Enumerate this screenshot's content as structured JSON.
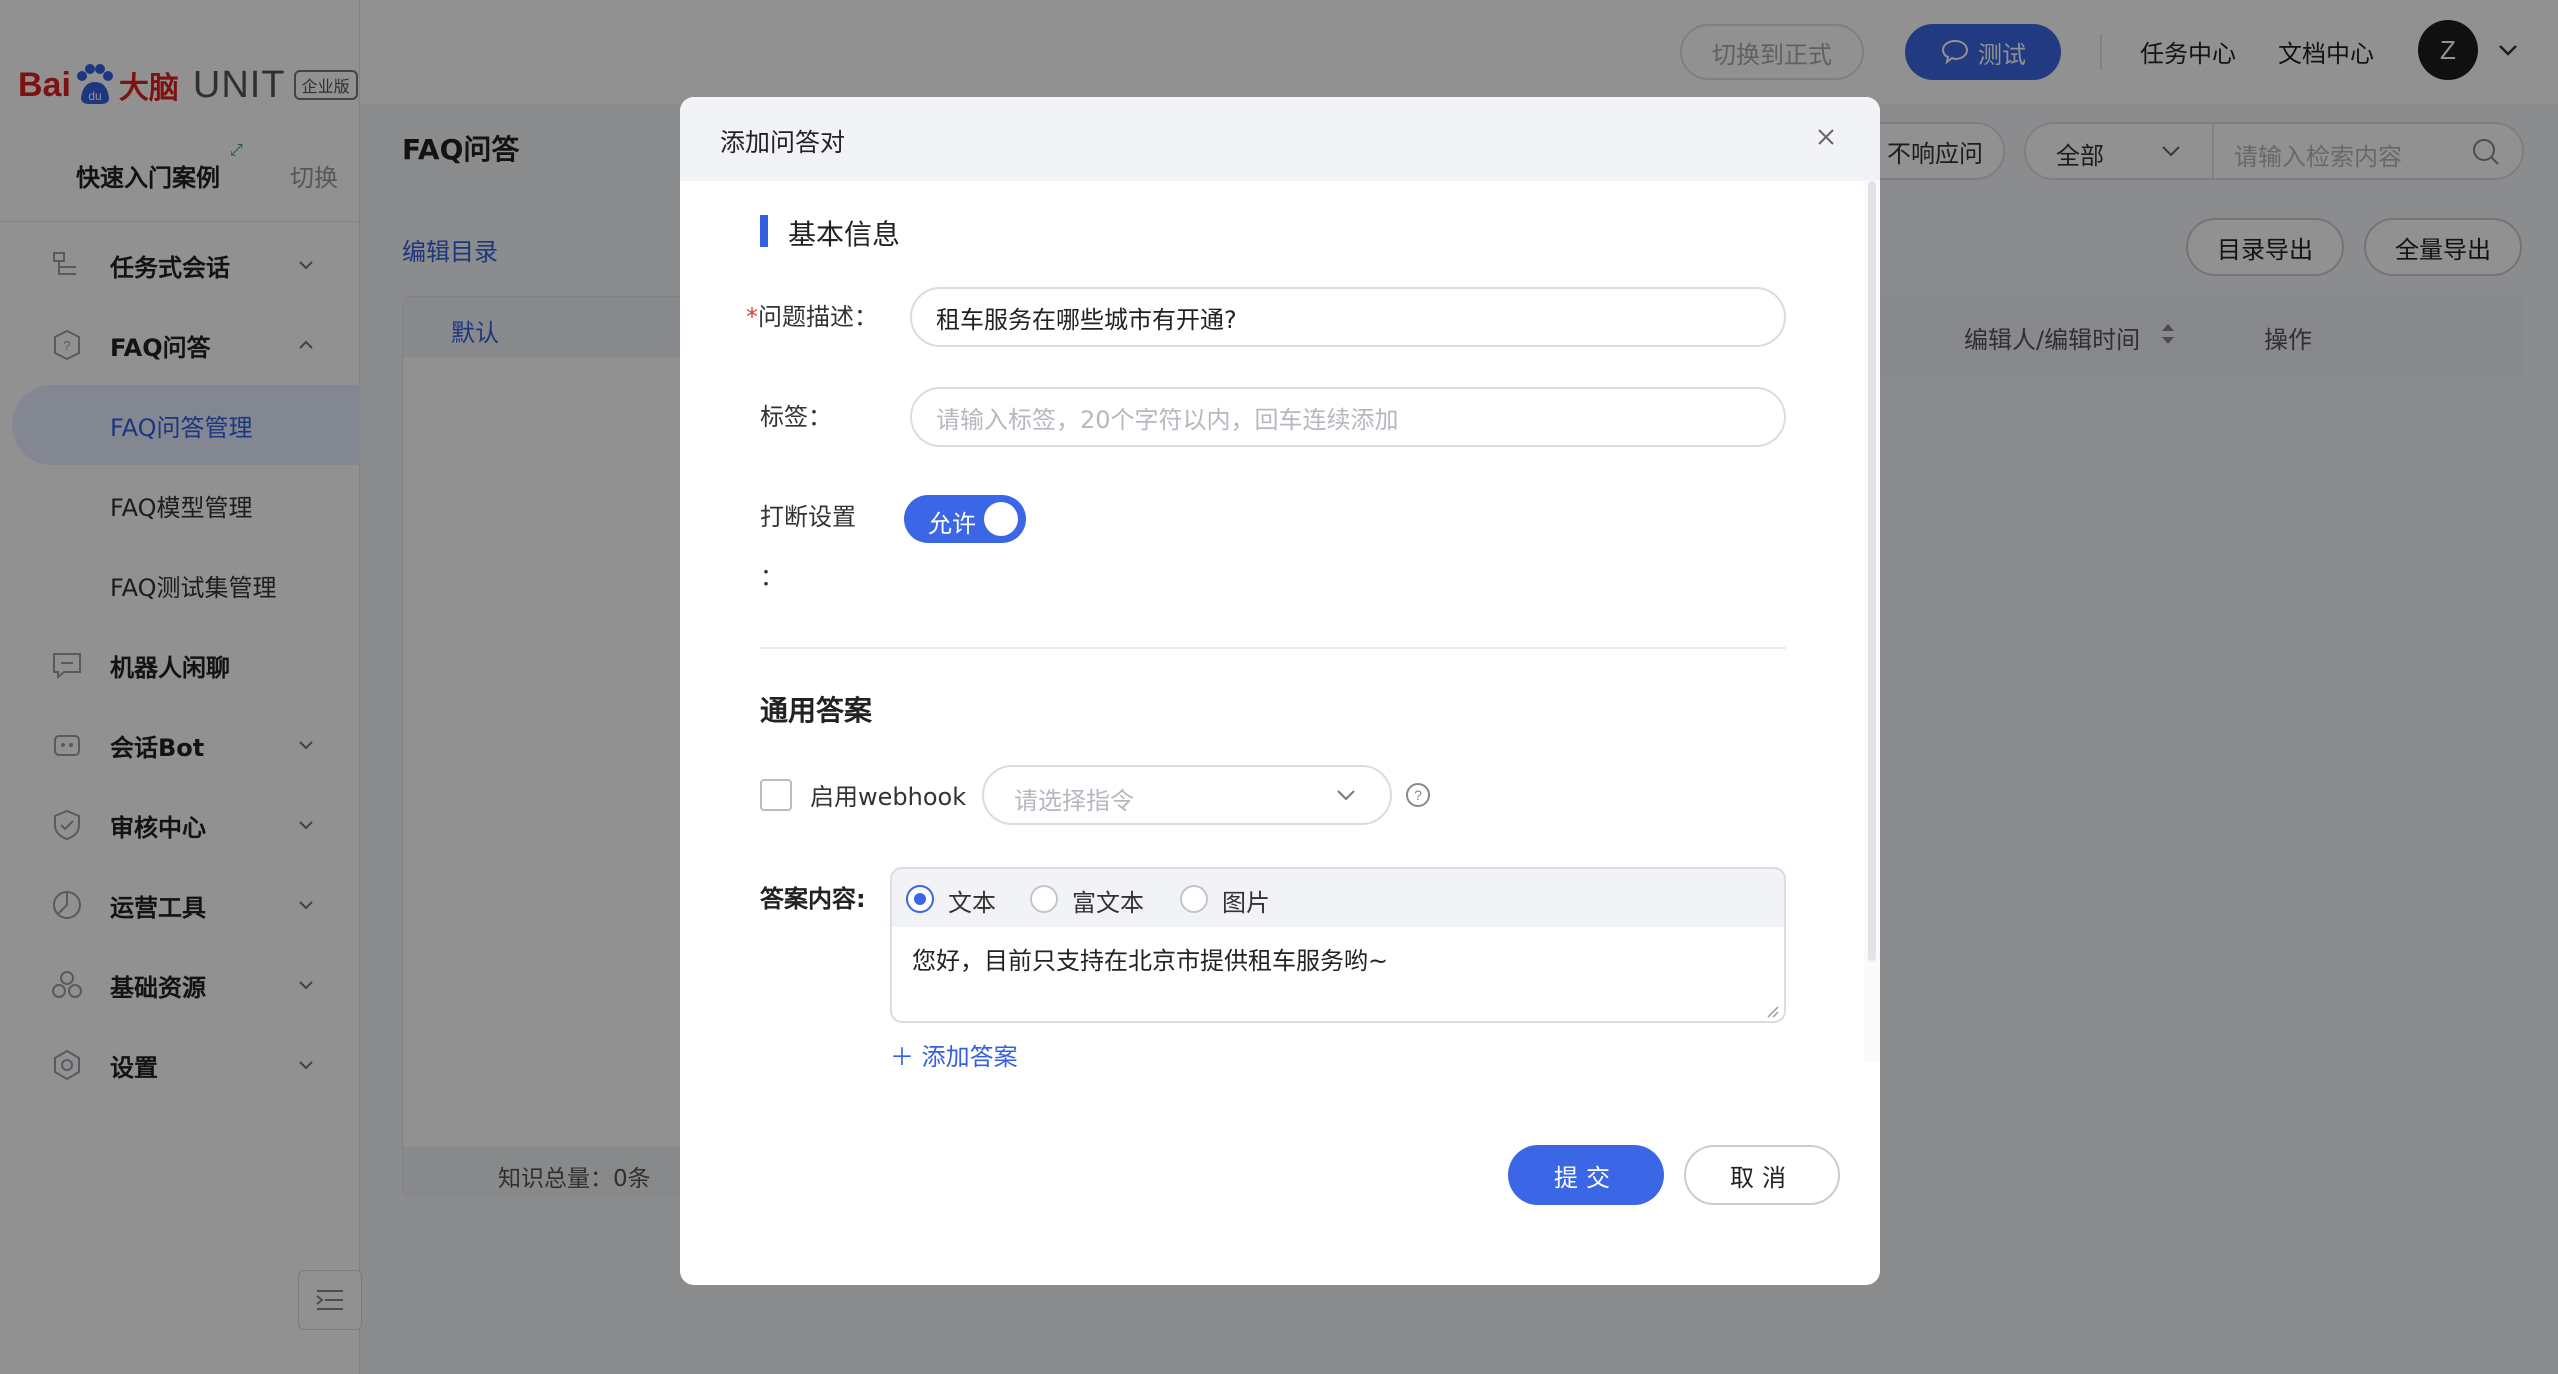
{
  "brand": {
    "bai": "Bai",
    "danao": "大脑",
    "unit": "UNIT",
    "edition": "企业版"
  },
  "quick": {
    "label": "快速入门案例",
    "badge": "⤢",
    "switch": "切换"
  },
  "sidebar": {
    "items": [
      {
        "label": "任务式会话",
        "icon": "task-dialog-icon"
      },
      {
        "label": "FAQ问答",
        "icon": "faq-icon",
        "expanded": true
      },
      {
        "label": "FAQ问答管理"
      },
      {
        "label": "FAQ模型管理"
      },
      {
        "label": "FAQ测试集管理"
      },
      {
        "label": "机器人闲聊",
        "icon": "chat-icon"
      },
      {
        "label": "会话Bot",
        "icon": "bot-icon"
      },
      {
        "label": "审核中心",
        "icon": "shield-icon"
      },
      {
        "label": "运营工具",
        "icon": "ops-icon"
      },
      {
        "label": "基础资源",
        "icon": "resource-icon"
      },
      {
        "label": "设置",
        "icon": "settings-icon"
      }
    ]
  },
  "topbar": {
    "switch_formal": "切换到正式",
    "test": "测试",
    "task_center": "任务中心",
    "doc_center": "文档中心",
    "avatar": "Z"
  },
  "main": {
    "title": "FAQ问答",
    "no_response": "不响应问",
    "filter_all": "全部",
    "search_placeholder": "请输入检索内容",
    "edit_dir": "编辑目录",
    "export_dir": "目录导出",
    "export_all": "全量导出",
    "dir_default": "默认",
    "total": "知识总量：0条",
    "col_editor": "编辑人/编辑时间",
    "col_ops": "操作"
  },
  "modal": {
    "title": "添加问答对",
    "section_basic": "基本信息",
    "question_label": "问题描述：",
    "question_required": "*",
    "question_value": "租车服务在哪些城市有开通?",
    "tag_label": "标签：",
    "tag_placeholder": "请输入标签，20个字符以内，回车连续添加",
    "interrupt_label": "打断设置",
    "interrupt_colon": "：",
    "toggle_text": "允许",
    "section_answer": "通用答案",
    "webhook_label": "启用webhook",
    "webhook_placeholder": "请选择指令",
    "answer_label": "答案内容:",
    "answer_types": [
      "文本",
      "富文本",
      "图片"
    ],
    "answer_selected": "文本",
    "answer_text": "您好，目前只支持在北京市提供租车服务哟~",
    "add_answer": "添加答案",
    "submit": "提交",
    "cancel": "取消"
  },
  "colors": {
    "primary": "#3b66e5",
    "link": "#3360e0",
    "brand_red": "#de1f1f",
    "overlay": "rgba(0,0,0,0.43)"
  }
}
